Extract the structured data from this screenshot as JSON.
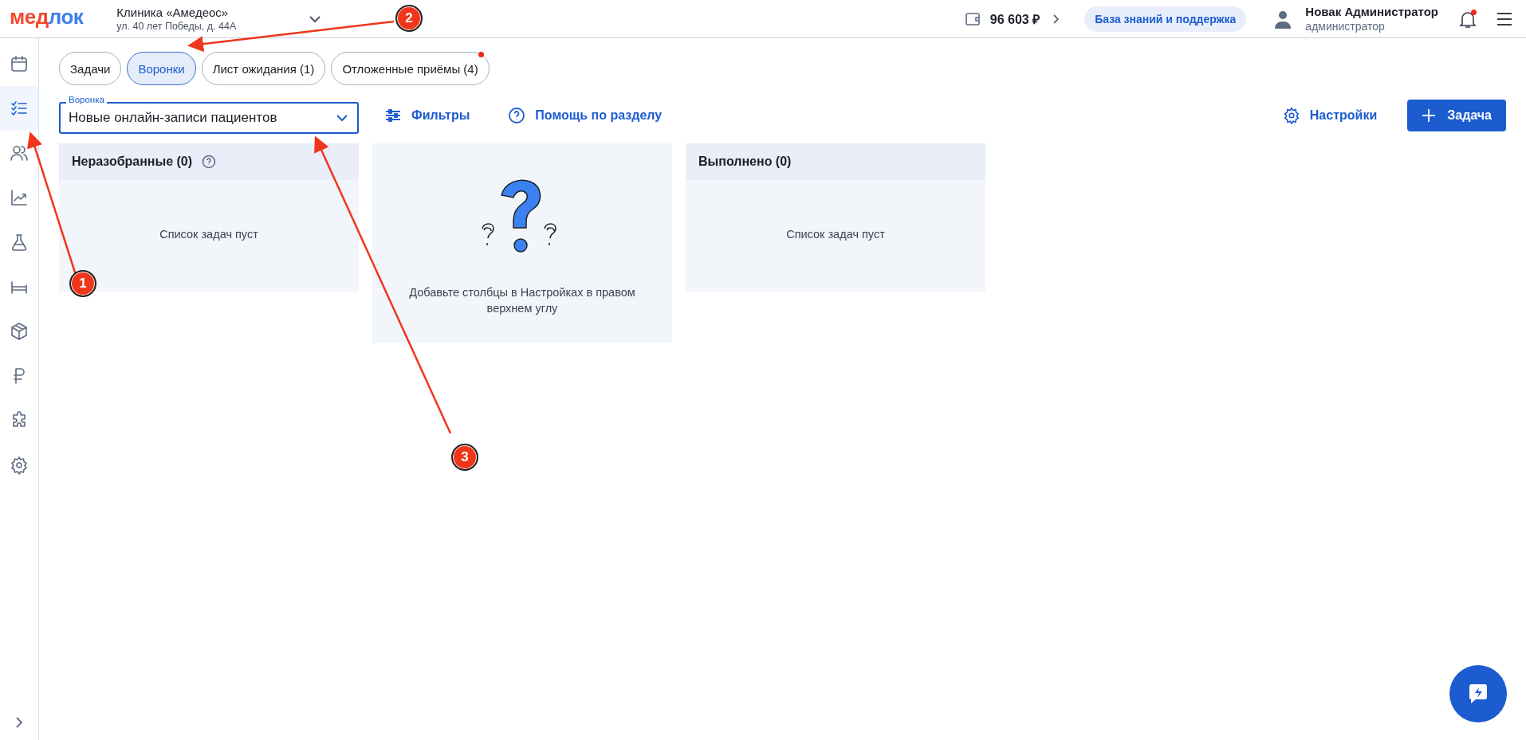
{
  "header": {
    "logo": [
      {
        "text": "мед",
        "color": "#f2492f"
      },
      {
        "text": "лок",
        "color": "#3b7fea"
      }
    ],
    "clinic": {
      "name": "Клиника «Амедеос»",
      "address": "ул. 40 лет Победы, д. 44А"
    },
    "balance": "96 603 ₽",
    "knowledge_button": "База знаний и поддержка",
    "user": {
      "name": "Новак Администратор",
      "role": "администратор"
    },
    "notifications_unread": true
  },
  "sidebar": {
    "items": [
      {
        "selected": false
      },
      {
        "selected": true
      },
      {
        "selected": false
      },
      {
        "selected": false
      },
      {
        "selected": false
      },
      {
        "selected": false
      },
      {
        "selected": false
      },
      {
        "selected": false
      },
      {
        "selected": false
      },
      {
        "selected": false
      }
    ]
  },
  "tabs": [
    {
      "label": "Задачи",
      "selected": false,
      "unread": false
    },
    {
      "label": "Воронки",
      "selected": true,
      "unread": false
    },
    {
      "label": "Лист ожидания (1)",
      "selected": false,
      "unread": false
    },
    {
      "label": "Отложенные приёмы (4)",
      "selected": false,
      "unread": true
    }
  ],
  "toolbar": {
    "funnel_select": {
      "label": "Воронка",
      "value": "Новые онлайн-записи пациентов"
    },
    "filters": "Фильтры",
    "help": "Помощь по разделу",
    "settings": "Настройки",
    "add_button": "Задача"
  },
  "columns": [
    {
      "kind": "column",
      "title": "Неразобранные (0)",
      "help_icon": true,
      "empty_text": "Список задач пуст"
    },
    {
      "kind": "placeholder",
      "text": "Добавьте столбцы в Настройках в правом верхнем углу"
    },
    {
      "kind": "column",
      "title": "Выполнено (0)",
      "help_icon": false,
      "empty_text": "Список задач пуст"
    }
  ],
  "annotations": [
    {
      "number": "1"
    },
    {
      "number": "2"
    },
    {
      "number": "3"
    }
  ]
}
